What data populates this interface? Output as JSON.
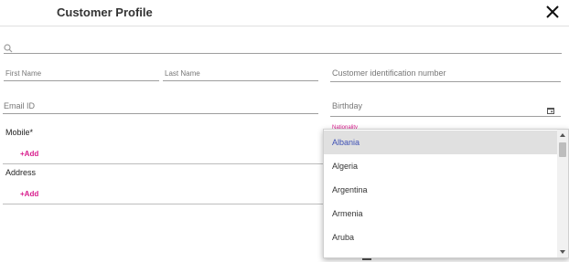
{
  "header": {
    "title": "Customer Profile",
    "close_icon": "close-icon"
  },
  "search": {
    "icon": "search-icon",
    "placeholder": "",
    "value": ""
  },
  "fields": {
    "first_name": "First Name",
    "last_name": "Last Name",
    "customer_id": "Customer identification number",
    "email": "Email ID",
    "birthday": "Birthday",
    "nationality": "Nationality"
  },
  "sections": {
    "mobile": {
      "label": "Mobile*",
      "add": "+Add"
    },
    "address": {
      "label": "Address",
      "add": "+Add"
    }
  },
  "dropdown": {
    "items": [
      "Albania",
      "Algeria",
      "Argentina",
      "Armenia",
      "Aruba"
    ],
    "selected": "Albania"
  },
  "colors": {
    "accent": "#d81b8c",
    "selected_text": "#3f51b5",
    "selected_bg": "#e0e0e0"
  }
}
